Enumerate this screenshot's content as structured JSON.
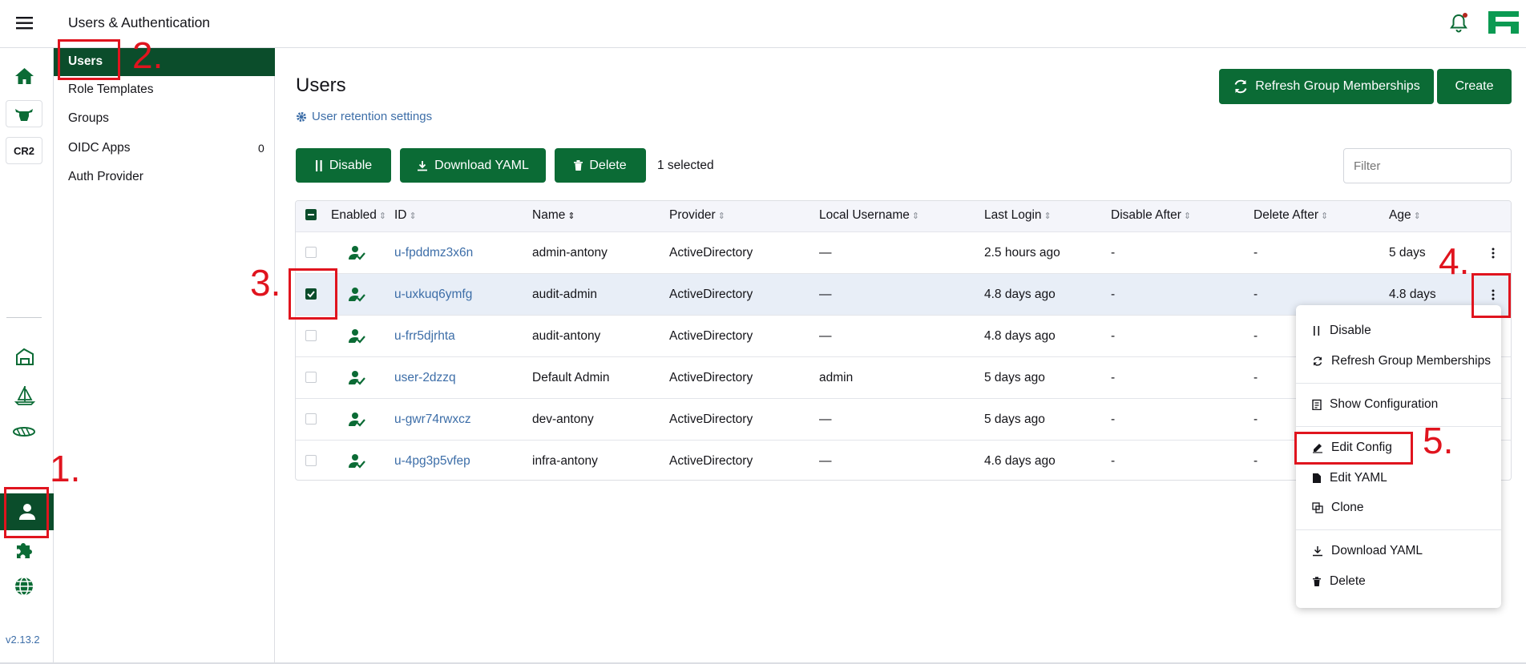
{
  "header": {
    "title": "Users & Authentication",
    "notification_icon": "bell-icon",
    "logo": "rancher-logo"
  },
  "left_rail": {
    "cluster_badge": "CR2",
    "version": "v2.13.2",
    "icons": [
      "home-icon",
      "cow-icon",
      "cluster-icon",
      "sail-icon",
      "fleet-icon",
      "user-icon",
      "extension-icon",
      "globe-icon"
    ]
  },
  "subnav": {
    "items": [
      {
        "label": "Users",
        "active": true
      },
      {
        "label": "Role Templates"
      },
      {
        "label": "Groups"
      },
      {
        "label": "OIDC Apps",
        "count": "0"
      },
      {
        "label": "Auth Provider"
      }
    ]
  },
  "main": {
    "title": "Users",
    "retention_link": "User retention settings",
    "refresh_button": "Refresh Group Memberships",
    "create_button": "Create",
    "bulk": {
      "disable": "Disable",
      "download_yaml": "Download YAML",
      "delete": "Delete",
      "selected_text": "1 selected"
    },
    "filter_placeholder": "Filter"
  },
  "table": {
    "columns": [
      "Enabled",
      "ID",
      "Name",
      "Provider",
      "Local Username",
      "Last Login",
      "Disable After",
      "Delete After",
      "Age"
    ],
    "rows": [
      {
        "id": "u-fpddmz3x6n",
        "name": "admin-antony",
        "provider": "ActiveDirectory",
        "local_username": "—",
        "last_login": "2.5 hours ago",
        "disable_after": "-",
        "delete_after": "-",
        "age": "5 days",
        "checked": false
      },
      {
        "id": "u-uxkuq6ymfg",
        "name": "audit-admin",
        "provider": "ActiveDirectory",
        "local_username": "—",
        "last_login": "4.8 days ago",
        "disable_after": "-",
        "delete_after": "-",
        "age": "4.8 days",
        "checked": true
      },
      {
        "id": "u-frr5djrhta",
        "name": "audit-antony",
        "provider": "ActiveDirectory",
        "local_username": "—",
        "last_login": "4.8 days ago",
        "disable_after": "-",
        "delete_after": "-",
        "age": "",
        "checked": false
      },
      {
        "id": "user-2dzzq",
        "name": "Default Admin",
        "provider": "ActiveDirectory",
        "local_username": "admin",
        "last_login": "5 days ago",
        "disable_after": "-",
        "delete_after": "-",
        "age": "",
        "checked": false
      },
      {
        "id": "u-gwr74rwxcz",
        "name": "dev-antony",
        "provider": "ActiveDirectory",
        "local_username": "—",
        "last_login": "5 days ago",
        "disable_after": "-",
        "delete_after": "-",
        "age": "",
        "checked": false
      },
      {
        "id": "u-4pg3p5vfep",
        "name": "infra-antony",
        "provider": "ActiveDirectory",
        "local_username": "—",
        "last_login": "4.6 days ago",
        "disable_after": "-",
        "delete_after": "-",
        "age": "",
        "checked": false
      }
    ]
  },
  "context_menu": {
    "items": [
      {
        "label": "Disable",
        "icon": "pause-icon"
      },
      {
        "label": "Refresh Group Memberships",
        "icon": "refresh-icon"
      },
      {
        "label": "Show Configuration",
        "icon": "clipboard-icon"
      },
      {
        "label": "Edit Config",
        "icon": "pencil-icon"
      },
      {
        "label": "Edit YAML",
        "icon": "file-icon"
      },
      {
        "label": "Clone",
        "icon": "copy-icon"
      },
      {
        "label": "Download YAML",
        "icon": "download-icon"
      },
      {
        "label": "Delete",
        "icon": "trash-icon"
      }
    ]
  },
  "annotations": [
    "1.",
    "2.",
    "3.",
    "4.",
    "5."
  ],
  "colors": {
    "primary": "#0b6b35",
    "annotation": "#e0141e",
    "link": "#3d6ea8"
  }
}
